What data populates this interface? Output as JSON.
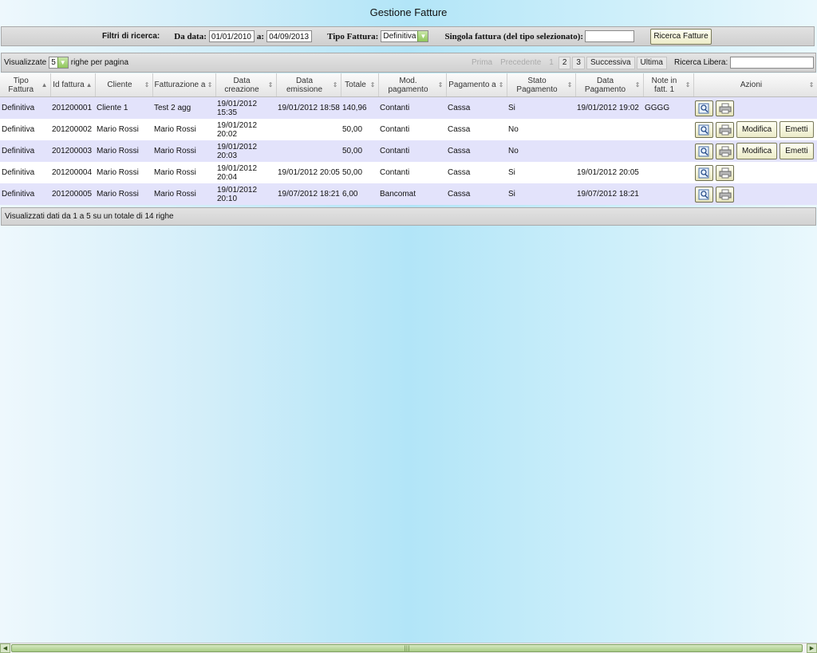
{
  "page": {
    "title": "Gestione Fatture"
  },
  "filters": {
    "label": "Filtri di ricerca:",
    "from_label": "Da data:",
    "from_value": "01/01/2010",
    "to_label": "a:",
    "to_value": "04/09/2013",
    "type_label": "Tipo Fattura:",
    "type_value": "Definitiva",
    "single_label": "Singola fattura (del tipo selezionato):",
    "single_value": "",
    "search_button": "Ricerca Fatture"
  },
  "toolbar": {
    "show_label": "Visualizzate",
    "rows_value": "5",
    "rows_suffix": "righe per pagina",
    "pagination": {
      "first": "Prima",
      "prev": "Precedente",
      "p1": "1",
      "p2": "2",
      "p3": "3",
      "next": "Successiva",
      "last": "Ultima"
    },
    "free_search_label": "Ricerca Libera:",
    "free_search_value": ""
  },
  "table": {
    "headers": [
      "Tipo Fattura",
      "Id fattura",
      "Cliente",
      "Fatturazione a",
      "Data creazione",
      "Data emissione",
      "Totale",
      "Mod. pagamento",
      "Pagamento a",
      "Stato Pagamento",
      "Data Pagamento",
      "Note in fatt. 1",
      "Azioni"
    ],
    "rows": [
      {
        "tipo": "Definitiva",
        "id": "201200001",
        "cliente": "Cliente 1",
        "fatt": "Test 2 agg",
        "creazione": "19/01/2012 15:35",
        "emissione": "19/01/2012 18:58",
        "totale": "140,96",
        "mod": "Contanti",
        "pag_a": "Cassa",
        "stato": "Si",
        "data_pag": "19/01/2012 19:02",
        "note": "GGGG",
        "modifica": "",
        "emetti": ""
      },
      {
        "tipo": "Definitiva",
        "id": "201200002",
        "cliente": "Mario Rossi",
        "fatt": "Mario Rossi",
        "creazione": "19/01/2012 20:02",
        "emissione": "",
        "totale": "50,00",
        "mod": "Contanti",
        "pag_a": "Cassa",
        "stato": "No",
        "data_pag": "",
        "note": "",
        "modifica": "Modifica",
        "emetti": "Emetti"
      },
      {
        "tipo": "Definitiva",
        "id": "201200003",
        "cliente": "Mario Rossi",
        "fatt": "Mario Rossi",
        "creazione": "19/01/2012 20:03",
        "emissione": "",
        "totale": "50,00",
        "mod": "Contanti",
        "pag_a": "Cassa",
        "stato": "No",
        "data_pag": "",
        "note": "",
        "modifica": "Modifica",
        "emetti": "Emetti"
      },
      {
        "tipo": "Definitiva",
        "id": "201200004",
        "cliente": "Mario Rossi",
        "fatt": "Mario Rossi",
        "creazione": "19/01/2012 20:04",
        "emissione": "19/01/2012 20:05",
        "totale": "50,00",
        "mod": "Contanti",
        "pag_a": "Cassa",
        "stato": "Si",
        "data_pag": "19/01/2012 20:05",
        "note": "",
        "modifica": "",
        "emetti": ""
      },
      {
        "tipo": "Definitiva",
        "id": "201200005",
        "cliente": "Mario Rossi",
        "fatt": "Mario Rossi",
        "creazione": "19/01/2012 20:10",
        "emissione": "19/07/2012 18:21",
        "totale": "6,00",
        "mod": "Bancomat",
        "pag_a": "Cassa",
        "stato": "Si",
        "data_pag": "19/07/2012 18:21",
        "note": "",
        "modifica": "",
        "emetti": ""
      }
    ]
  },
  "status": {
    "text": "Visualizzati dati da 1 a 5 su un totale di 14 righe"
  },
  "icons": {
    "view": "magnifier-icon",
    "print": "printer-icon"
  },
  "colors": {
    "row_odd": "#e3e3fb",
    "row_even": "#ffffff",
    "button_bg": "#f5f3d8"
  }
}
